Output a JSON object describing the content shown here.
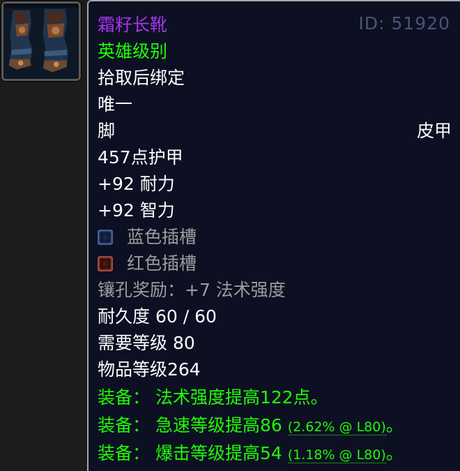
{
  "item": {
    "icon": "leather-boots-icon",
    "name": "霜籽长靴",
    "id_text": "ID: 51920",
    "quality": "英雄级别",
    "bind": "拾取后绑定",
    "unique": "唯一",
    "slot": "脚",
    "armor_type": "皮甲",
    "armor": "457点护甲",
    "stats": [
      "+92 耐力",
      "+92 智力"
    ],
    "sockets": [
      {
        "label": "蓝色插槽",
        "color": "#3e5ea8",
        "icon": "blue-socket-icon"
      },
      {
        "label": "红色插槽",
        "color": "#a8473a",
        "icon": "red-socket-icon"
      }
    ],
    "socket_bonus": "镶孔奖励：+7 法术强度",
    "durability": "耐久度 60 / 60",
    "required_level": "需要等级 80",
    "item_level": "物品等级264",
    "equip": [
      {
        "text": "装备： 法术强度提高122点。",
        "rating": "",
        "suffix": ""
      },
      {
        "text": "装备： 急速等级提高86 ",
        "rating": "(2.62% @ L80)",
        "suffix": "。"
      },
      {
        "text": "装备： 爆击等级提高54 ",
        "rating": "(1.18% @ L80)",
        "suffix": "。"
      }
    ]
  },
  "colors": {
    "name": "#a335ee",
    "green": "#1eff00",
    "white": "#ffffff",
    "gray": "#9d9d9d",
    "id": "#4b5573",
    "background": "#0d0f23"
  }
}
